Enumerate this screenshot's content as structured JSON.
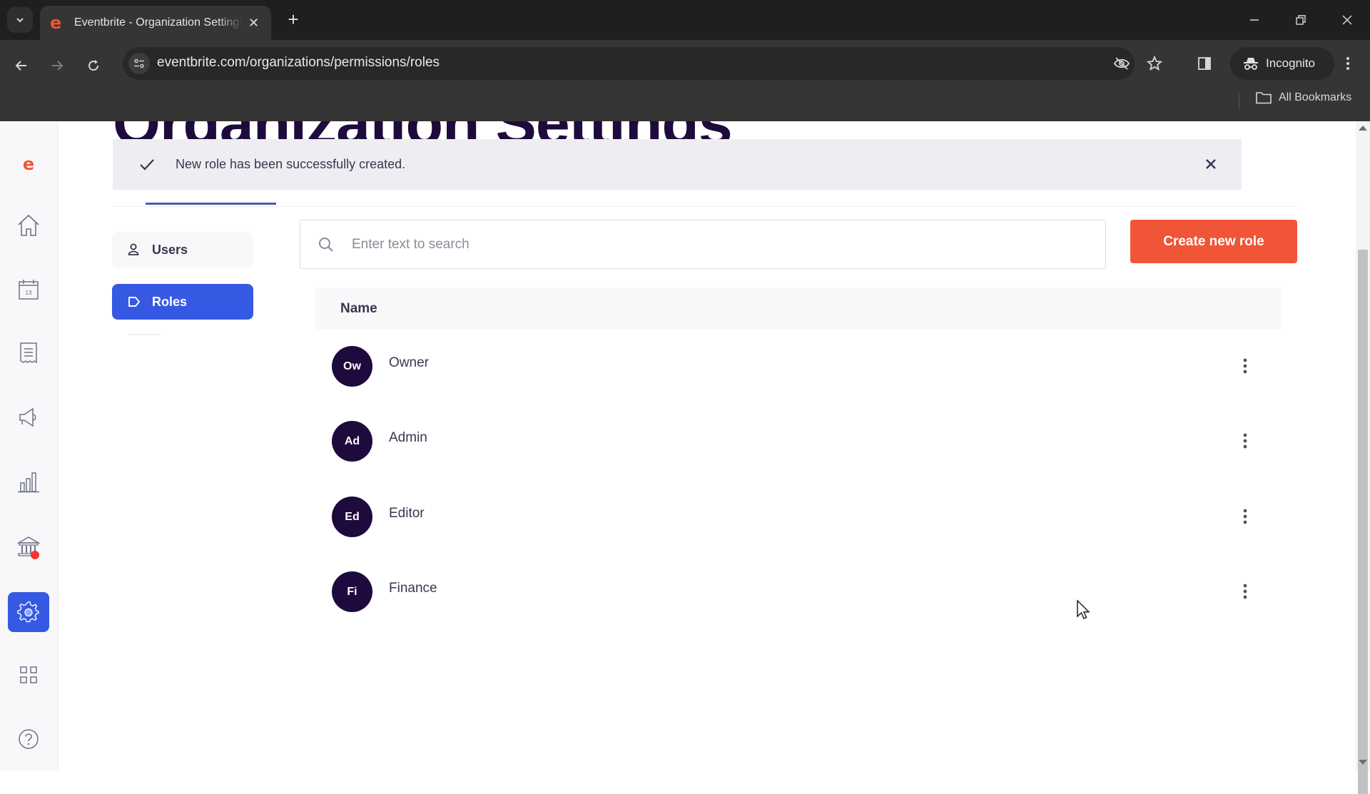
{
  "browser": {
    "tab_title": "Eventbrite - Organization Settings",
    "tab_favicon": "e",
    "url": "eventbrite.com/organizations/permissions/roles",
    "profile_label": "Incognito",
    "bookmarks_label": "All Bookmarks"
  },
  "sidebar": {
    "items": [
      {
        "name": "eventbrite-logo",
        "icon": "e"
      },
      {
        "name": "home",
        "icon": "home-icon"
      },
      {
        "name": "events",
        "icon": "calendar-icon",
        "badge_text": "13"
      },
      {
        "name": "orders",
        "icon": "receipt-icon"
      },
      {
        "name": "marketing",
        "icon": "megaphone-icon"
      },
      {
        "name": "reports",
        "icon": "bar-chart-icon"
      },
      {
        "name": "finance",
        "icon": "bank-icon",
        "notification": true
      },
      {
        "name": "org-settings",
        "icon": "gear-icon",
        "active": true
      },
      {
        "name": "app-marketplace",
        "icon": "grid-icon"
      },
      {
        "name": "help",
        "icon": "help-icon"
      }
    ]
  },
  "page": {
    "title": "Organization Settings",
    "toast": {
      "message": "New role has been successfully created."
    },
    "subnav": {
      "users_label": "Users",
      "roles_label": "Roles"
    },
    "search": {
      "placeholder": "Enter text to search",
      "value": ""
    },
    "create_button_label": "Create new role",
    "table": {
      "column_header": "Name",
      "rows": [
        {
          "initials": "Ow",
          "name": "Owner"
        },
        {
          "initials": "Ad",
          "name": "Admin"
        },
        {
          "initials": "Ed",
          "name": "Editor"
        },
        {
          "initials": "Fi",
          "name": "Finance"
        }
      ]
    }
  },
  "colors": {
    "brand_orange": "#f05537",
    "active_blue": "#3659e3",
    "avatar_bg": "#1e0a3c",
    "toast_bg": "#eeeef2"
  }
}
